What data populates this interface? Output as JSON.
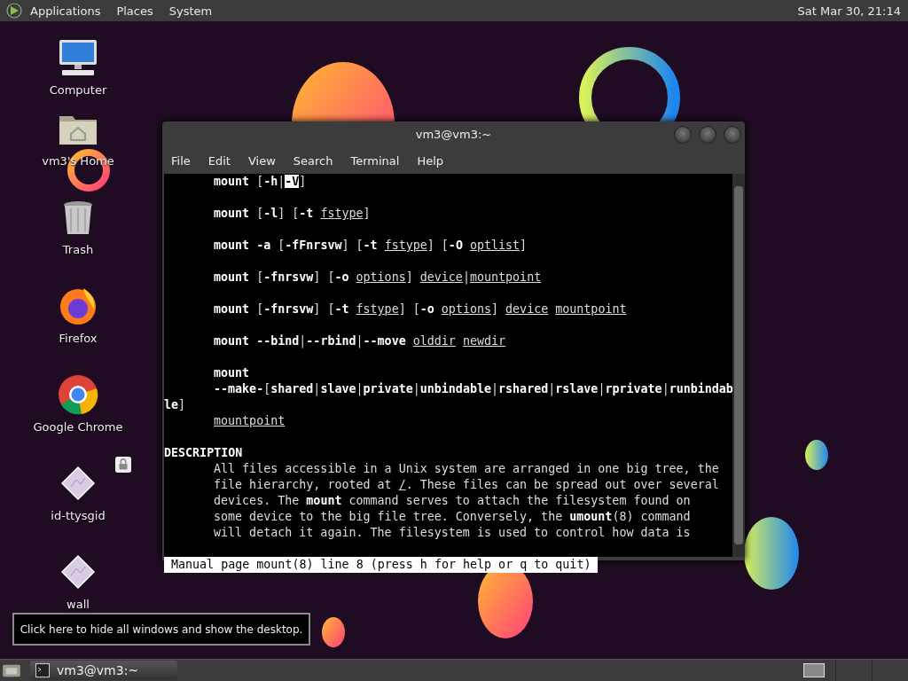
{
  "top_panel": {
    "menus": [
      "Applications",
      "Places",
      "System"
    ],
    "clock": "Sat Mar 30, 21:14"
  },
  "desktop_icons": [
    {
      "label": "Computer",
      "kind": "computer",
      "locked": false
    },
    {
      "label": "vm3's Home",
      "kind": "home",
      "locked": false
    },
    {
      "label": "Trash",
      "kind": "trash",
      "locked": false
    },
    {
      "label": "Firefox",
      "kind": "firefox",
      "locked": false
    },
    {
      "label": "Google Chrome",
      "kind": "chrome",
      "locked": false
    },
    {
      "label": "id-ttysgid",
      "kind": "script",
      "locked": true
    },
    {
      "label": "wall",
      "kind": "script",
      "locked": false
    }
  ],
  "terminal": {
    "title": "vm3@vm3:~",
    "menus": [
      "File",
      "Edit",
      "View",
      "Search",
      "Terminal",
      "Help"
    ],
    "blocks": [
      [
        {
          "indent": true,
          "segments": [
            {
              "text": "mount",
              "kind": "bold"
            },
            {
              "text": " [",
              "kind": "plain"
            },
            {
              "text": "-h",
              "kind": "bold"
            },
            {
              "text": "|",
              "kind": "plain"
            },
            {
              "text": "-V",
              "kind": "reverse"
            },
            {
              "text": "]",
              "kind": "plain"
            }
          ]
        }
      ],
      [
        {
          "indent": true,
          "segments": [
            {
              "text": "mount",
              "kind": "bold"
            },
            {
              "text": " [",
              "kind": "plain"
            },
            {
              "text": "-l",
              "kind": "bold"
            },
            {
              "text": "] [",
              "kind": "plain"
            },
            {
              "text": "-t ",
              "kind": "bold"
            },
            {
              "text": "fstype",
              "kind": "underline"
            },
            {
              "text": "]",
              "kind": "plain"
            }
          ]
        }
      ],
      [
        {
          "indent": true,
          "segments": [
            {
              "text": "mount -a",
              "kind": "bold"
            },
            {
              "text": " [",
              "kind": "plain"
            },
            {
              "text": "-fFnrsvw",
              "kind": "bold"
            },
            {
              "text": "] [",
              "kind": "plain"
            },
            {
              "text": "-t ",
              "kind": "bold"
            },
            {
              "text": "fstype",
              "kind": "underline"
            },
            {
              "text": "] [",
              "kind": "plain"
            },
            {
              "text": "-O ",
              "kind": "bold"
            },
            {
              "text": "optlist",
              "kind": "underline"
            },
            {
              "text": "]",
              "kind": "plain"
            }
          ]
        }
      ],
      [
        {
          "indent": true,
          "segments": [
            {
              "text": "mount",
              "kind": "bold"
            },
            {
              "text": " [",
              "kind": "plain"
            },
            {
              "text": "-fnrsvw",
              "kind": "bold"
            },
            {
              "text": "] [",
              "kind": "plain"
            },
            {
              "text": "-o ",
              "kind": "bold"
            },
            {
              "text": "options",
              "kind": "underline"
            },
            {
              "text": "] ",
              "kind": "plain"
            },
            {
              "text": "device",
              "kind": "underline"
            },
            {
              "text": "|",
              "kind": "plain"
            },
            {
              "text": "mountpoint",
              "kind": "underline"
            }
          ]
        }
      ],
      [
        {
          "indent": true,
          "segments": [
            {
              "text": "mount",
              "kind": "bold"
            },
            {
              "text": " [",
              "kind": "plain"
            },
            {
              "text": "-fnrsvw",
              "kind": "bold"
            },
            {
              "text": "] [",
              "kind": "plain"
            },
            {
              "text": "-t ",
              "kind": "bold"
            },
            {
              "text": "fstype",
              "kind": "underline"
            },
            {
              "text": "] [",
              "kind": "plain"
            },
            {
              "text": "-o ",
              "kind": "bold"
            },
            {
              "text": "options",
              "kind": "underline"
            },
            {
              "text": "] ",
              "kind": "plain"
            },
            {
              "text": "device mountpoint",
              "kind": "underline"
            }
          ]
        }
      ],
      [
        {
          "indent": true,
          "segments": [
            {
              "text": "mount --bind",
              "kind": "bold"
            },
            {
              "text": "|",
              "kind": "plain"
            },
            {
              "text": "--rbind",
              "kind": "bold"
            },
            {
              "text": "|",
              "kind": "plain"
            },
            {
              "text": "--move ",
              "kind": "bold"
            },
            {
              "text": "olddir newdir",
              "kind": "underline"
            }
          ]
        }
      ],
      [
        {
          "indent": true,
          "segments": [
            {
              "text": "mount",
              "kind": "bold"
            }
          ]
        },
        {
          "indent": true,
          "segments": [
            {
              "text": "--make-",
              "kind": "bold"
            },
            {
              "text": "[",
              "kind": "plain"
            },
            {
              "text": "shared",
              "kind": "bold"
            },
            {
              "text": "|",
              "kind": "plain"
            },
            {
              "text": "slave",
              "kind": "bold"
            },
            {
              "text": "|",
              "kind": "plain"
            },
            {
              "text": "private",
              "kind": "bold"
            },
            {
              "text": "|",
              "kind": "plain"
            },
            {
              "text": "unbindable",
              "kind": "bold"
            },
            {
              "text": "|",
              "kind": "plain"
            },
            {
              "text": "rshared",
              "kind": "bold"
            },
            {
              "text": "|",
              "kind": "plain"
            },
            {
              "text": "rslave",
              "kind": "bold"
            },
            {
              "text": "|",
              "kind": "plain"
            },
            {
              "text": "rprivate",
              "kind": "bold"
            },
            {
              "text": "|",
              "kind": "plain"
            },
            {
              "text": "runbindab",
              "kind": "bold"
            }
          ]
        },
        {
          "indent": false,
          "segments": [
            {
              "text": "le",
              "kind": "bold"
            },
            {
              "text": "]",
              "kind": "plain"
            }
          ]
        },
        {
          "indent": true,
          "segments": [
            {
              "text": "mountpoint",
              "kind": "underline"
            }
          ]
        }
      ],
      [
        {
          "indent": false,
          "segments": [
            {
              "text": "DESCRIPTION",
              "kind": "bold"
            }
          ]
        },
        {
          "indent": true,
          "segments": [
            {
              "text": "All files accessible in a Unix system are arranged in one big tree, the",
              "kind": "plain"
            }
          ]
        },
        {
          "indent": true,
          "segments": [
            {
              "text": "file hierarchy, rooted at ",
              "kind": "plain"
            },
            {
              "text": "/",
              "kind": "underline"
            },
            {
              "text": ". These files can be spread out over several",
              "kind": "plain"
            }
          ]
        },
        {
          "indent": true,
          "segments": [
            {
              "text": "devices. The ",
              "kind": "plain"
            },
            {
              "text": "mount",
              "kind": "bold"
            },
            {
              "text": " command serves to attach the filesystem found on",
              "kind": "plain"
            }
          ]
        },
        {
          "indent": true,
          "segments": [
            {
              "text": "some device to the big file tree. Conversely, the ",
              "kind": "plain"
            },
            {
              "text": "umount",
              "kind": "bold"
            },
            {
              "text": "(8) command",
              "kind": "plain"
            }
          ]
        },
        {
          "indent": true,
          "segments": [
            {
              "text": "will detach it again. The filesystem is used to control how data is",
              "kind": "plain"
            }
          ]
        }
      ]
    ],
    "status": "Manual page mount(8) line 8 (press h for help or q to quit)"
  },
  "tooltip": "Click here to hide all windows and show the desktop.",
  "taskbar": {
    "tasks": [
      {
        "label": "vm3@vm3:~"
      }
    ]
  }
}
